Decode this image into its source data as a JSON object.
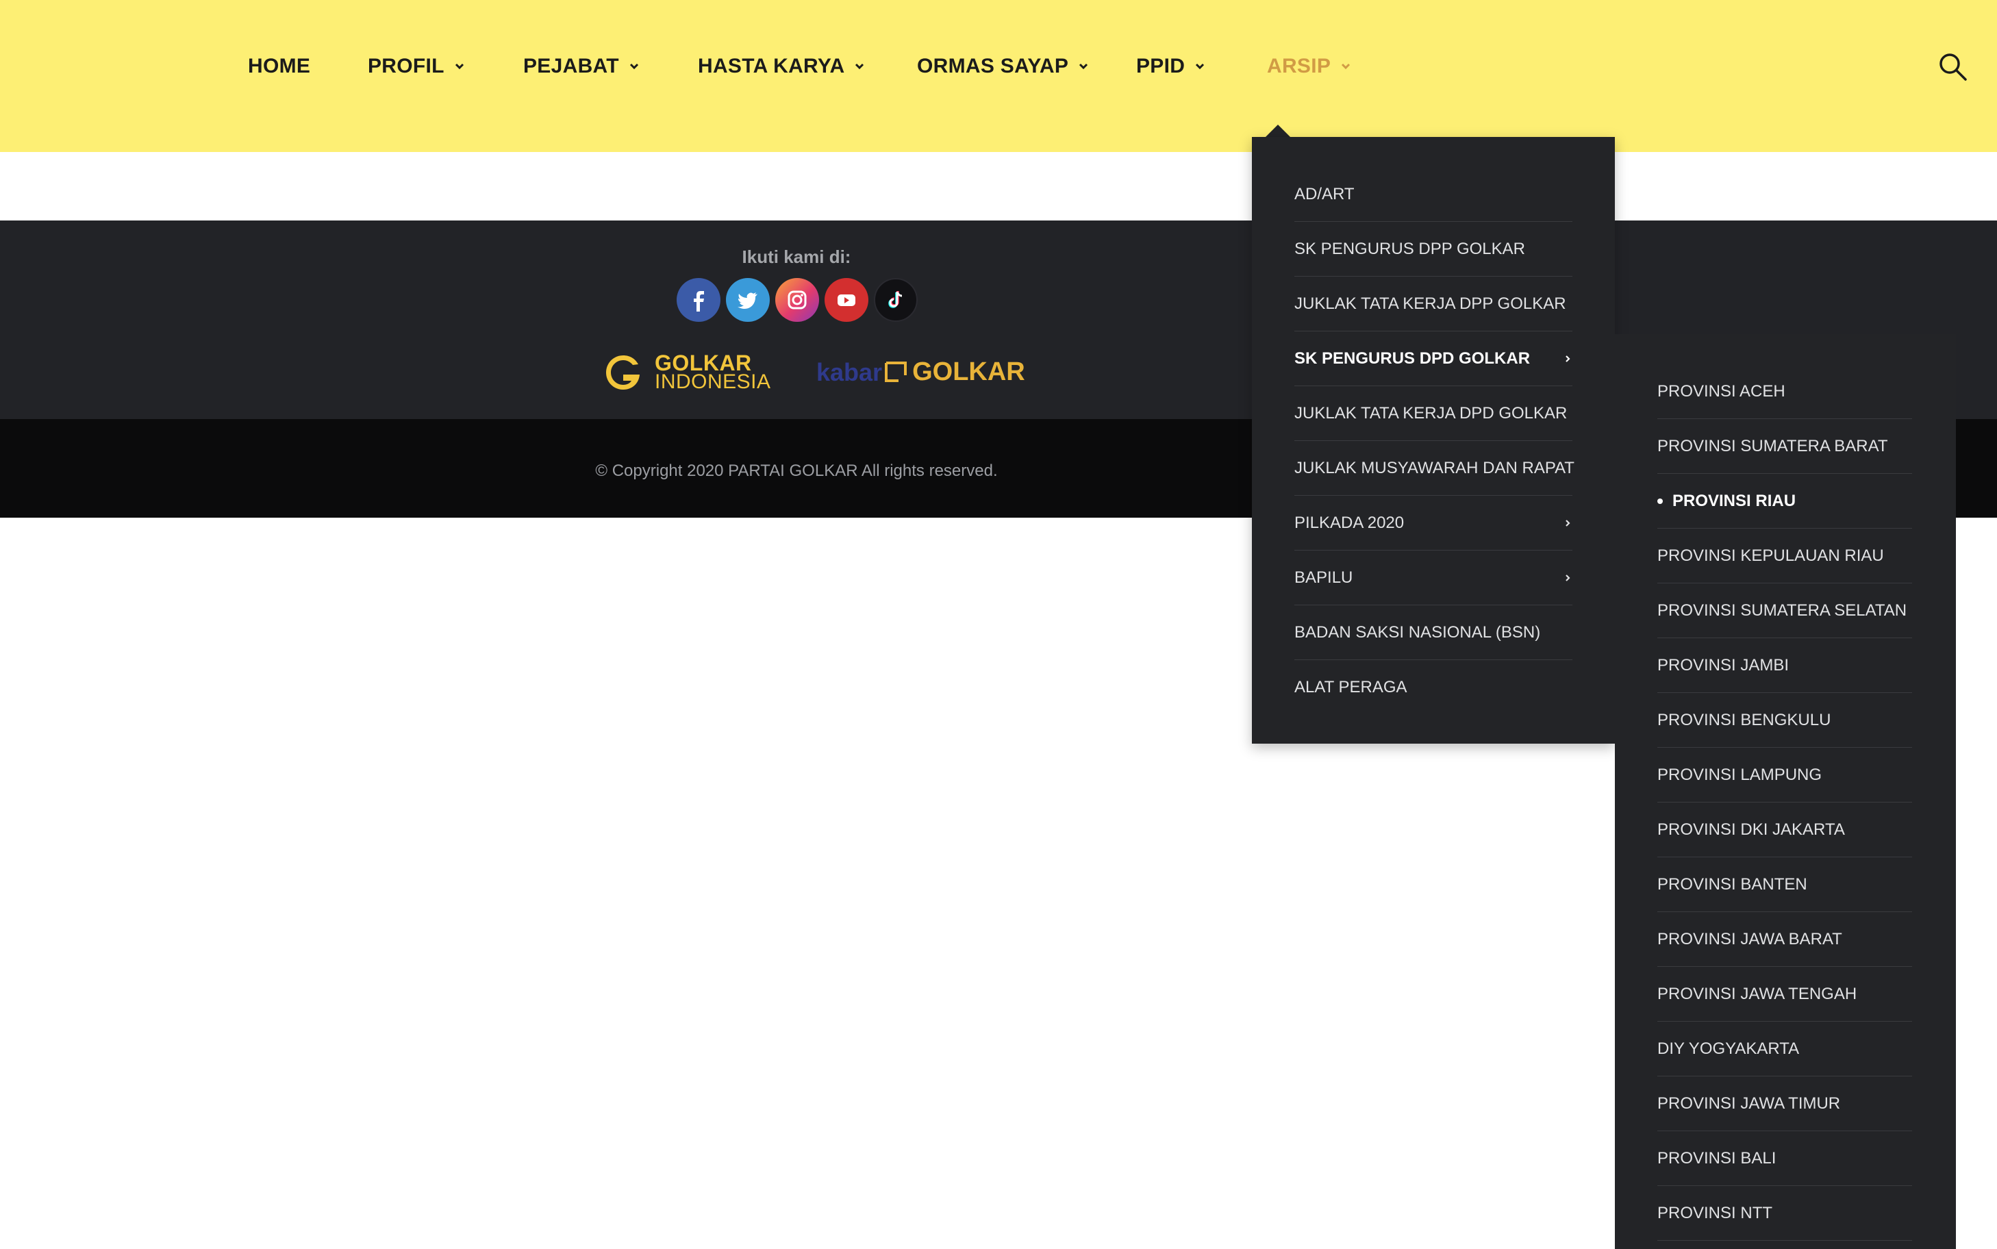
{
  "nav": {
    "items": [
      {
        "label": "HOME"
      },
      {
        "label": "PROFIL"
      },
      {
        "label": "PEJABAT"
      },
      {
        "label": "HASTA KARYA"
      },
      {
        "label": "ORMAS SAYAP"
      },
      {
        "label": "PPID"
      },
      {
        "label": "ARSIP"
      }
    ],
    "active_color": "#d19b45",
    "search_icon": "search-icon"
  },
  "colors": {
    "header_bg": "#fdef74",
    "footer_top_bg": "#222327",
    "footer_bottom_bg": "#0b0b0c",
    "dropdown_bg": "#232427"
  },
  "footer": {
    "follow_label": "Ikuti kami di:",
    "socials": [
      "facebook-icon",
      "twitter-icon",
      "instagram-icon",
      "youtube-icon",
      "tiktok-icon"
    ],
    "logo_golkar": {
      "line1": "GOLKAR",
      "line2": "INDONESIA"
    },
    "logo_kabar": {
      "part1": "kabar",
      "part2": "GOLKAR"
    },
    "copyright": "© Copyright 2020 PARTAI GOLKAR All rights reserved."
  },
  "dropdown": {
    "items": [
      {
        "label": "AD/ART"
      },
      {
        "label": "SK PENGURUS DPP GOLKAR"
      },
      {
        "label": "JUKLAK TATA KERJA DPP GOLKAR"
      },
      {
        "label": "SK PENGURUS DPD GOLKAR"
      },
      {
        "label": "JUKLAK TATA KERJA DPD GOLKAR"
      },
      {
        "label": "JUKLAK MUSYAWARAH DAN RAPAT"
      },
      {
        "label": "PILKADA 2020"
      },
      {
        "label": "BAPILU"
      },
      {
        "label": "BADAN SAKSI NASIONAL (BSN)"
      },
      {
        "label": "ALAT PERAGA"
      }
    ]
  },
  "submenu": {
    "items": [
      {
        "label": "PROVINSI ACEH"
      },
      {
        "label": "PROVINSI SUMATERA BARAT"
      },
      {
        "label": "PROVINSI RIAU"
      },
      {
        "label": "PROVINSI KEPULAUAN RIAU"
      },
      {
        "label": "PROVINSI SUMATERA SELATAN"
      },
      {
        "label": "PROVINSI JAMBI"
      },
      {
        "label": "PROVINSI BENGKULU"
      },
      {
        "label": "PROVINSI LAMPUNG"
      },
      {
        "label": "PROVINSI DKI JAKARTA"
      },
      {
        "label": "PROVINSI BANTEN"
      },
      {
        "label": "PROVINSI JAWA BARAT"
      },
      {
        "label": "PROVINSI JAWA TENGAH"
      },
      {
        "label": "DIY YOGYAKARTA"
      },
      {
        "label": "PROVINSI JAWA TIMUR"
      },
      {
        "label": "PROVINSI BALI"
      },
      {
        "label": "PROVINSI NTT"
      }
    ]
  }
}
